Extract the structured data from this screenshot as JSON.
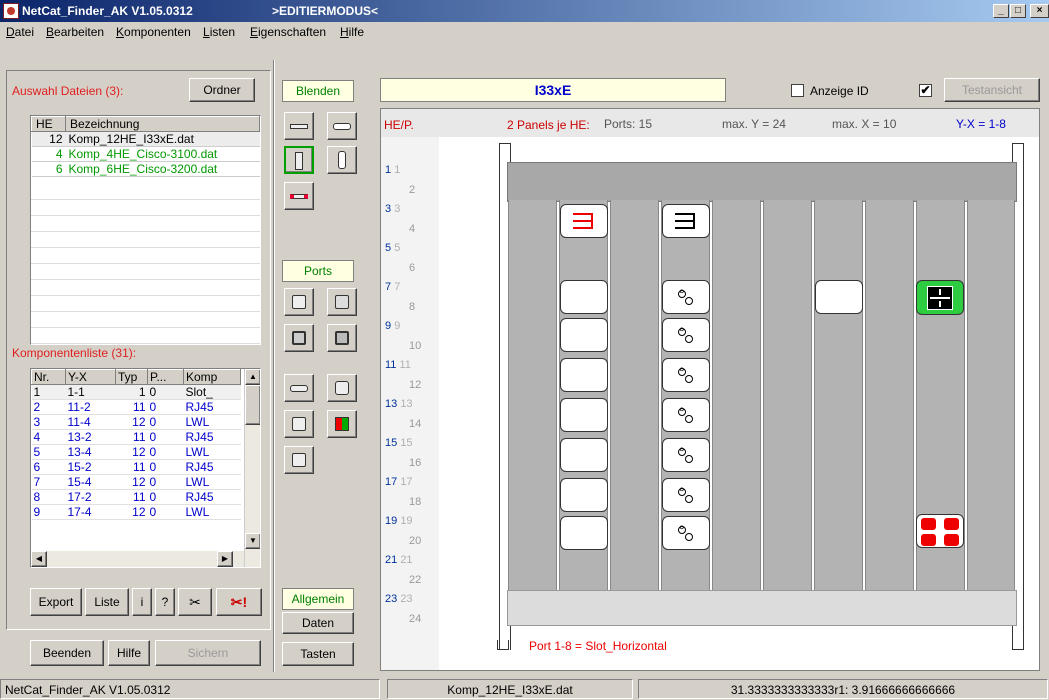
{
  "window": {
    "title": "NetCat_Finder_AK  V1.05.0312",
    "mode": ">EDITIERMODUS<",
    "min": "_",
    "max": "□",
    "close": "×"
  },
  "menu": [
    "Datei",
    "Bearbeiten",
    "Komponenten",
    "Listen",
    "Eigenschaften",
    "Hilfe"
  ],
  "files": {
    "label": "Auswahl Dateien (3):",
    "folder_button": "Ordner",
    "headers": [
      "HE",
      "Bezeichnung"
    ],
    "rows": [
      {
        "he": "12",
        "name": "Komp_12HE_I33xE.dat"
      },
      {
        "he": "4",
        "name": "Komp_4HE_Cisco-3100.dat"
      },
      {
        "he": "6",
        "name": "Komp_6HE_Cisco-3200.dat"
      }
    ]
  },
  "components": {
    "label": "Komponentenliste (31):",
    "headers": [
      "Nr.",
      "Y-X",
      "Typ",
      "P...",
      "Komp"
    ],
    "rows": [
      [
        "1",
        "1-1",
        "1",
        "0",
        "Slot_"
      ],
      [
        "2",
        "11-2",
        "11",
        "0",
        "RJ45"
      ],
      [
        "3",
        "11-4",
        "12",
        "0",
        "LWL"
      ],
      [
        "4",
        "13-2",
        "11",
        "0",
        "RJ45"
      ],
      [
        "5",
        "13-4",
        "12",
        "0",
        "LWL"
      ],
      [
        "6",
        "15-2",
        "11",
        "0",
        "RJ45"
      ],
      [
        "7",
        "15-4",
        "12",
        "0",
        "LWL"
      ],
      [
        "8",
        "17-2",
        "11",
        "0",
        "RJ45"
      ],
      [
        "9",
        "17-4",
        "12",
        "0",
        "LWL"
      ]
    ]
  },
  "bottom_buttons": {
    "export": "Export",
    "liste": "Liste",
    "info": "i",
    "help": "?",
    "cut": "✂",
    "cut_all": "✂!"
  },
  "footer_buttons": {
    "beenden": "Beenden",
    "hilfe": "Hilfe",
    "sichern": "Sichern"
  },
  "mid": {
    "blenden": "Blenden",
    "ports": "Ports",
    "allgemein": "Allgemein",
    "daten": "Daten",
    "tasten": "Tasten"
  },
  "top": {
    "component_name": "I33xE",
    "anzeige_id": "Anzeige ID",
    "testansicht": "Testansicht"
  },
  "panel": {
    "hep": "HE/P.",
    "panels_per_he": "2 Panels je HE:",
    "ports": "Ports: 15",
    "maxy": "max. Y = 24",
    "maxx": "max. X = 10",
    "yx": "Y-X = 1-8",
    "footer": "Port 1-8 = Slot_Horizontal"
  },
  "status": {
    "app": "NetCat_Finder_AK  V1.05.0312",
    "file": "Komp_12HE_I33xE.dat",
    "coords": "31.3333333333333r1: 3.91666666666666"
  }
}
